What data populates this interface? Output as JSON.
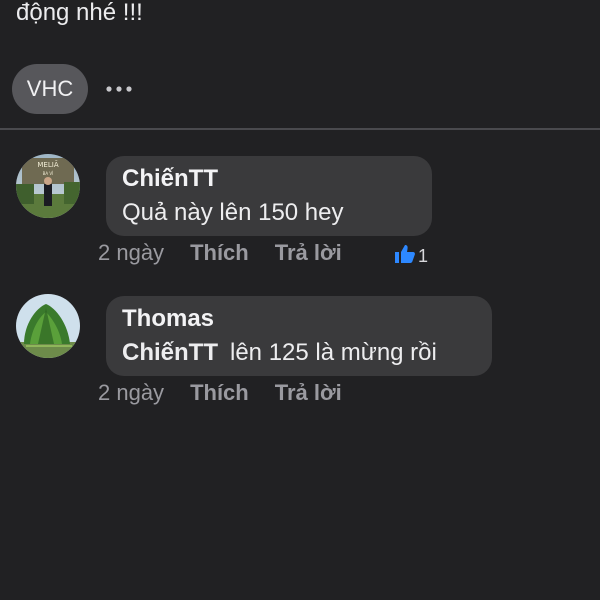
{
  "post": {
    "text_tail": "động nhé !!!",
    "tag": "VHC"
  },
  "comments": [
    {
      "author": "ChiếnTT",
      "text": "Quả này lên 150 hey",
      "time": "2 ngày",
      "like_label": "Thích",
      "reply_label": "Trả lời",
      "reaction_count": "1",
      "reaction_icon": "thumbs-up-icon",
      "avatar_sign_text": "MELIÃ",
      "avatar_sign_subtext": "BA VÌ"
    },
    {
      "author": "Thomas",
      "mention": "ChiếnTT",
      "text": "lên 125 là mừng rồi",
      "time": "2 ngày",
      "like_label": "Thích",
      "reply_label": "Trả lời"
    }
  ],
  "colors": {
    "background": "#212123",
    "bubble": "#3a3a3c",
    "chip": "#57575b",
    "like_blue": "#2d88ff",
    "meta_text": "#9a9aa0"
  }
}
